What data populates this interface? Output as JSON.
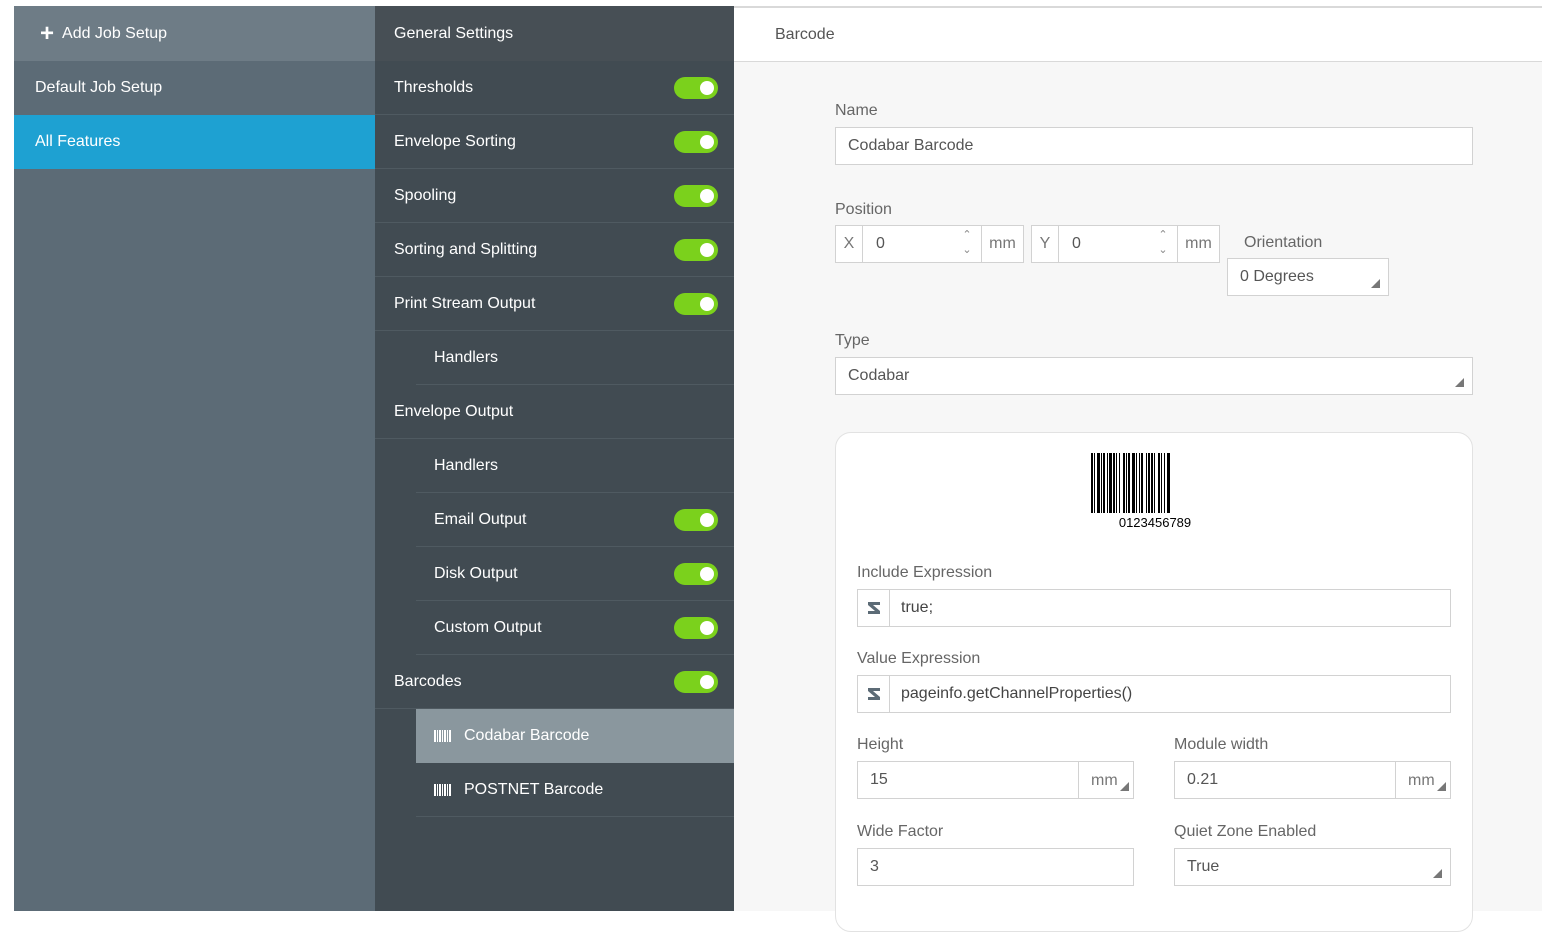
{
  "sidebar": {
    "add_label": "Add Job Setup",
    "items": [
      {
        "label": "Default Job Setup",
        "active": false
      },
      {
        "label": "All Features",
        "active": true
      }
    ]
  },
  "features": {
    "header": "General Settings",
    "rows": [
      {
        "label": "Thresholds",
        "toggle": true,
        "indent": false
      },
      {
        "label": "Envelope Sorting",
        "toggle": true,
        "indent": false
      },
      {
        "label": "Spooling",
        "toggle": true,
        "indent": false
      },
      {
        "label": "Sorting and Splitting",
        "toggle": true,
        "indent": false
      },
      {
        "label": "Print Stream Output",
        "toggle": true,
        "indent": false
      },
      {
        "label": "Handlers",
        "toggle": false,
        "indent": true
      },
      {
        "label": "Envelope Output",
        "toggle": false,
        "indent": false
      },
      {
        "label": "Handlers",
        "toggle": false,
        "indent": true
      },
      {
        "label": "Email Output",
        "toggle": true,
        "indent": true
      },
      {
        "label": "Disk Output",
        "toggle": true,
        "indent": true
      },
      {
        "label": "Custom Output",
        "toggle": true,
        "indent": true
      },
      {
        "label": "Barcodes",
        "toggle": true,
        "indent": false
      },
      {
        "label": "Codabar Barcode",
        "toggle": false,
        "indent": true,
        "icon": "barcode-icon",
        "selected": true
      },
      {
        "label": "POSTNET Barcode",
        "toggle": false,
        "indent": true,
        "icon": "barcode-icon"
      }
    ]
  },
  "panel": {
    "title": "Barcode",
    "name_label": "Name",
    "name_value": "Codabar Barcode",
    "position_label": "Position",
    "x_axis": "X",
    "x_value": "0",
    "x_unit": "mm",
    "y_axis": "Y",
    "y_value": "0",
    "y_unit": "mm",
    "orientation_label": "Orientation",
    "orientation_value": "0 Degrees",
    "type_label": "Type",
    "type_value": "Codabar",
    "preview_text": "0123456789",
    "include_label": "Include Expression",
    "include_value": "true;",
    "value_label": "Value Expression",
    "value_value": "pageinfo.getChannelProperties()",
    "height_label": "Height",
    "height_value": "15",
    "height_unit": "mm",
    "module_label": "Module width",
    "module_value": "0.21",
    "module_unit": "mm",
    "wide_label": "Wide Factor",
    "wide_value": "3",
    "quiet_label": "Quiet Zone Enabled",
    "quiet_value": "True"
  },
  "colors": {
    "accent": "#1ea1d2",
    "toggle_on": "#7bd11c",
    "sidebar_bg": "#5c6b76",
    "nav_bg": "#414b52",
    "selected_row": "#8a979e"
  }
}
